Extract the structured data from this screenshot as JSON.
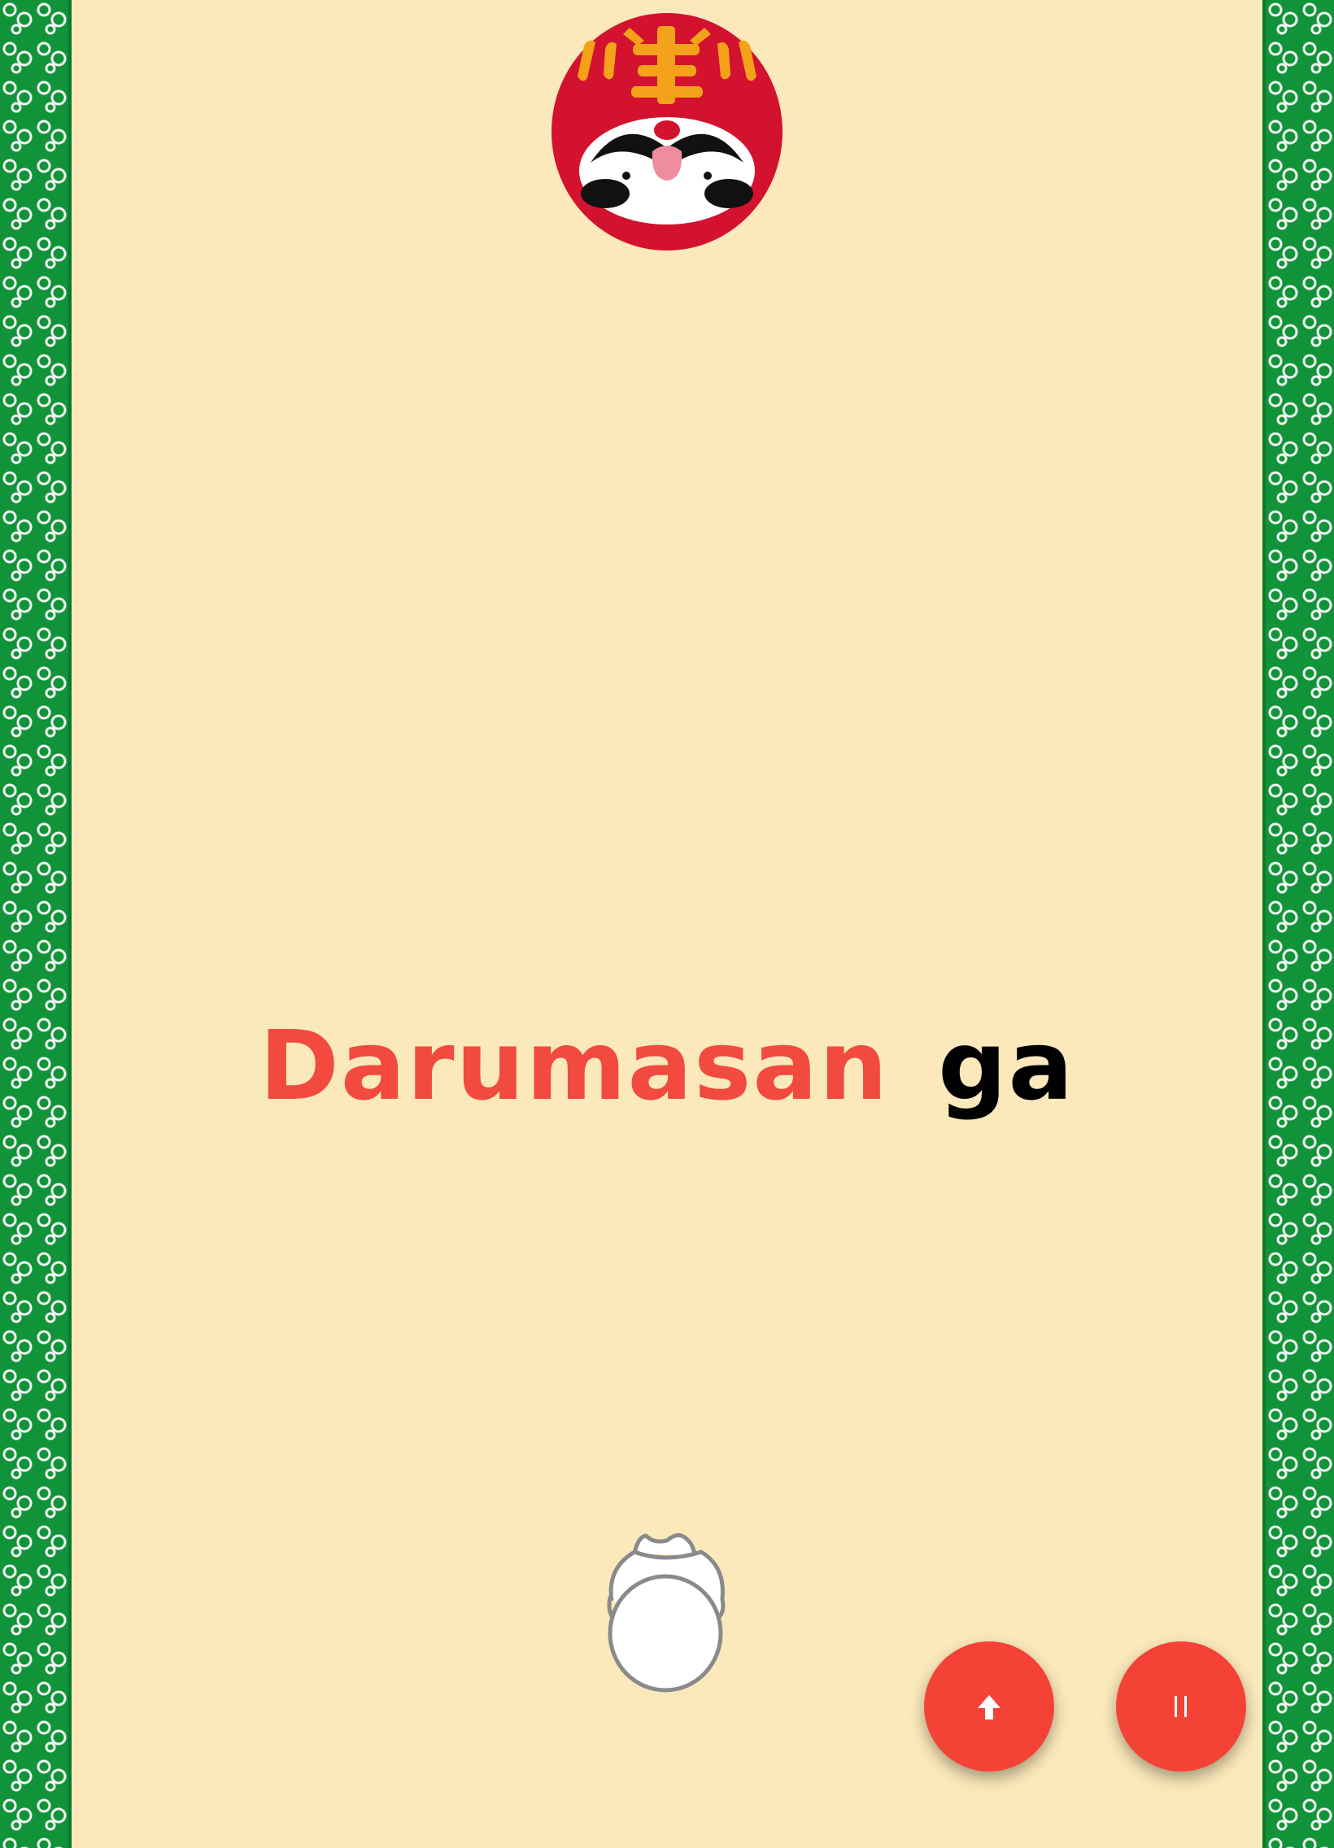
{
  "chant": {
    "highlighted": "Darumasan",
    "pending": "ga"
  },
  "daruma": {
    "icon": "daruma-icon",
    "colors": {
      "body": "#d3122f",
      "face": "#ffffff",
      "kanji": "#f4a21a"
    }
  },
  "player": {
    "icon": "player-head-icon"
  },
  "controls": {
    "forward_icon": "arrow-up-icon",
    "pause_icon": "pause-icon",
    "button_color": "#f44336"
  },
  "colors": {
    "background": "#fbe9bb",
    "border": "#11933a",
    "chant_highlight": "#f24a3e",
    "chant_pending": "#000000"
  }
}
